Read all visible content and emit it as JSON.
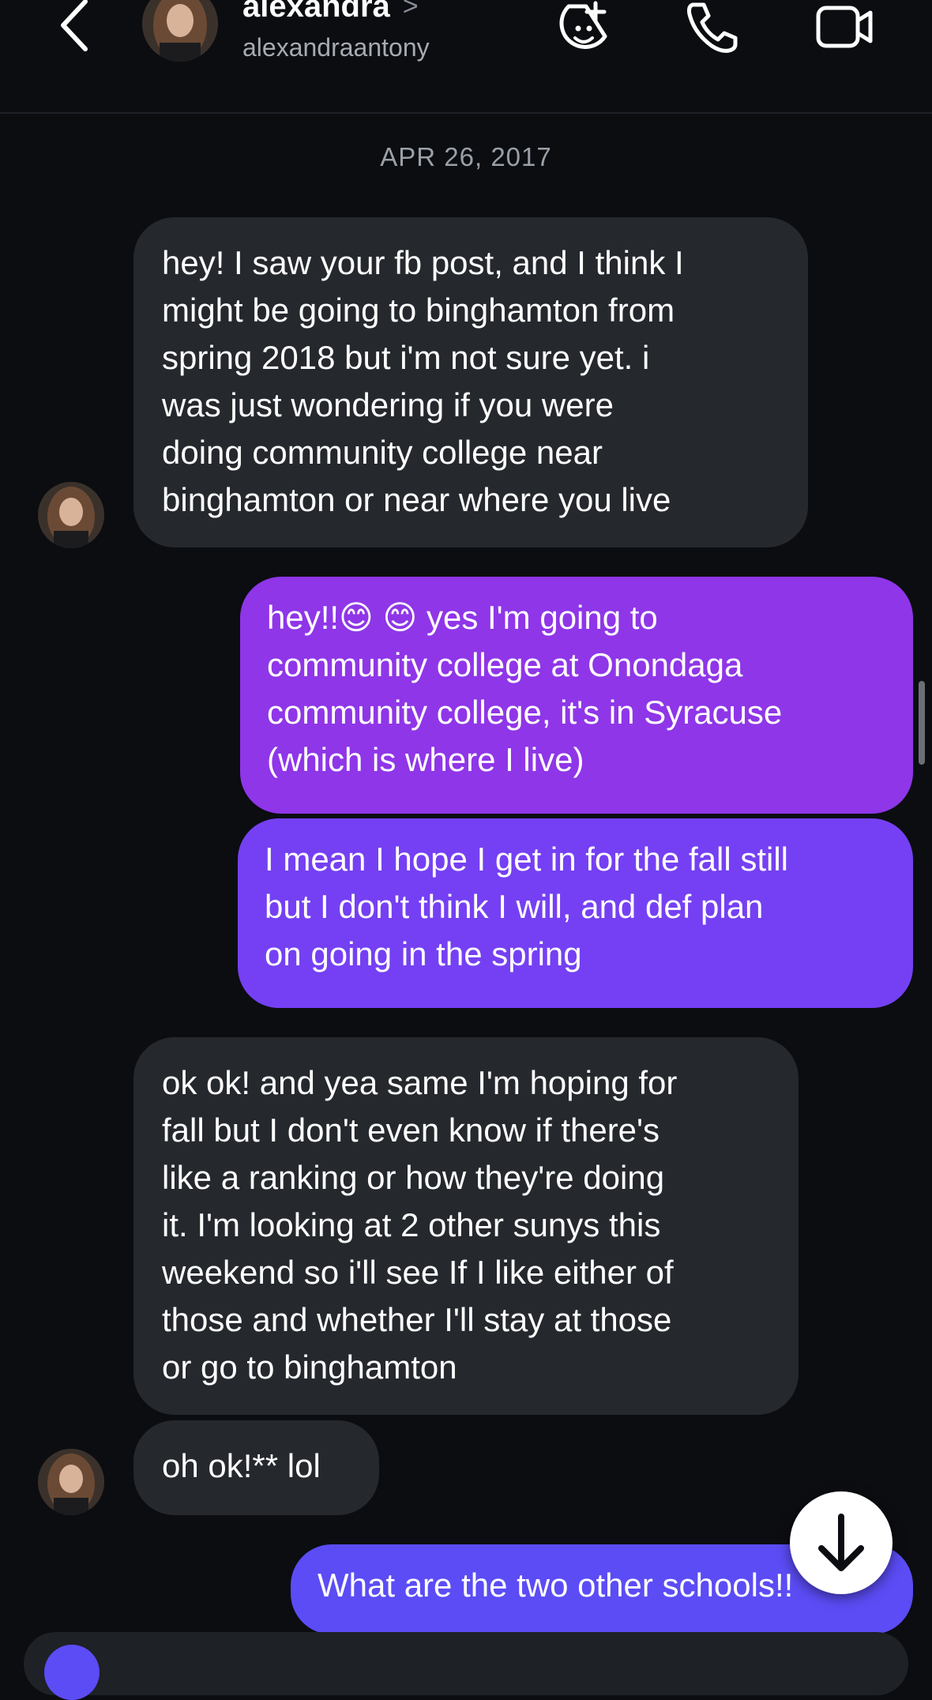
{
  "header": {
    "name": "alexandra",
    "chevron": ">",
    "username": "alexandraantony"
  },
  "date_separator": "APR 26, 2017",
  "messages": [
    {
      "direction": "incoming",
      "text": "hey! I saw your fb post, and I think I\nmight be going to binghamton from\nspring 2018 but i'm not sure yet. i\nwas just wondering if you were\ndoing community college near\nbinghamton or near where you live"
    },
    {
      "direction": "outgoing",
      "text": "hey!!😊 😊 yes I'm going to\ncommunity college at Onondaga\ncommunity college, it's in Syracuse\n(which is where I live)",
      "color": "#8f36e8"
    },
    {
      "direction": "outgoing",
      "text": "I mean I hope I get in for the fall still\nbut I don't think I will, and def plan\non going in the spring",
      "color": "#7540f3"
    },
    {
      "direction": "incoming",
      "text": "ok ok! and yea same I'm hoping for\nfall but I don't even know if there's\nlike a ranking or how they're doing\nit. I'm looking at 2 other sunys this\nweekend so i'll see If I like either of\nthose and whether I'll stay at those\nor go to binghamton"
    },
    {
      "direction": "incoming",
      "text": "oh ok!** lol"
    },
    {
      "direction": "outgoing",
      "text": "What are the two other schools!!",
      "color": "#5b4cf5"
    }
  ],
  "icons": {
    "back": "chevron-left-icon",
    "sticker": "sticker-add-icon",
    "call": "phone-icon",
    "video": "video-camera-icon",
    "scroll_down": "arrow-down-icon"
  },
  "colors": {
    "background": "#0b0d11",
    "incoming_bubble": "#25282d",
    "outgoing_top": "#8f36e8",
    "outgoing_mid": "#7540f3",
    "outgoing_bottom": "#5b4cf5"
  }
}
